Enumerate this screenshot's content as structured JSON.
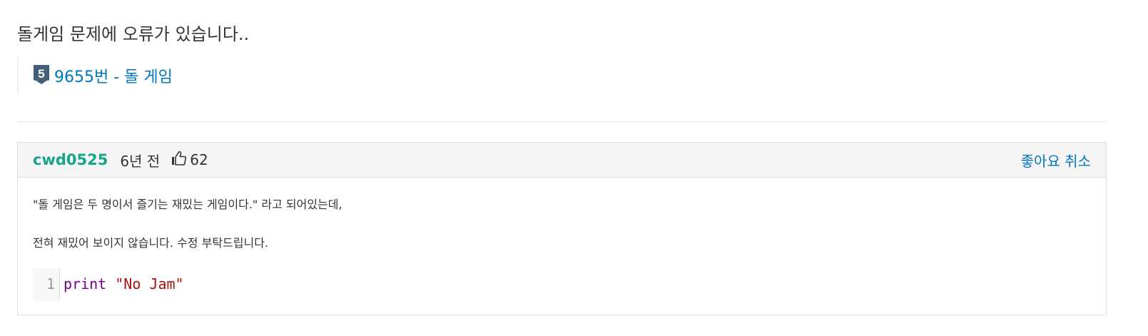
{
  "title": "돌게임 문제에 오류가 있습니다..",
  "problem": {
    "tier_number": "5",
    "link_text": "9655번 - 돌 게임",
    "tier_color": "#435f7a"
  },
  "post": {
    "author": "cwd0525",
    "time_ago": "6년 전",
    "like_count": "62",
    "unlike_label": "좋아요 취소",
    "paragraphs": [
      "\"돌 게임은 두 명이서 즐기는 재밌는 게임이다.\" 라고 되어있는데,",
      "전혀 재밌어 보이지 않습니다. 수정 부탁드립니다."
    ],
    "code": {
      "line_number": "1",
      "keyword": "print",
      "space": " ",
      "string": "\"No Jam\""
    }
  },
  "colors": {
    "author": "#17a589",
    "link": "#0076c0",
    "keyword": "#770088",
    "string": "#aa1111"
  }
}
